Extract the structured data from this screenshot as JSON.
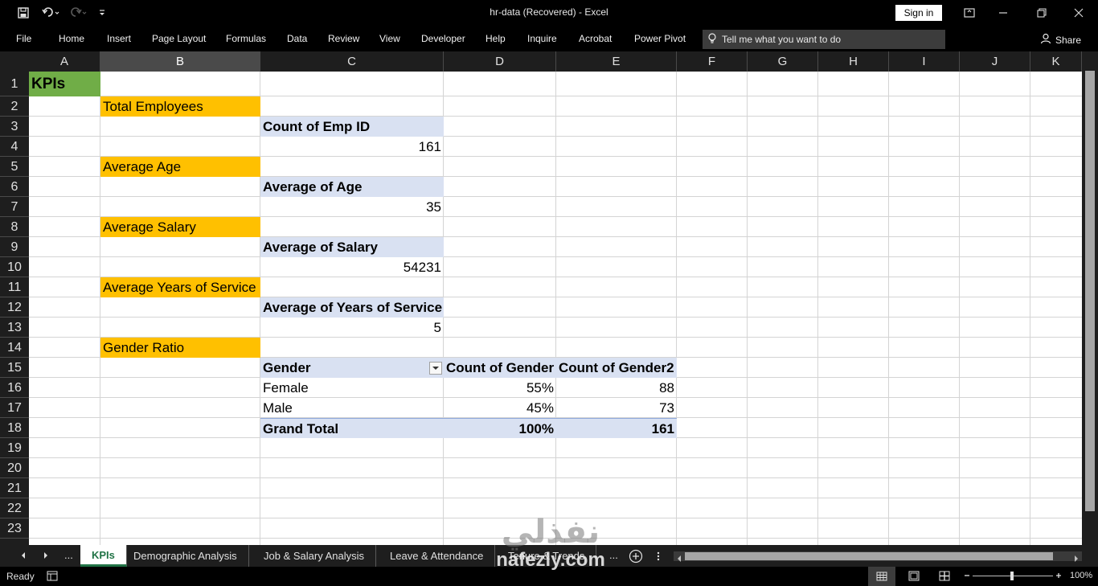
{
  "window": {
    "title": "hr-data (Recovered)  -  Excel",
    "signin_label": "Sign in",
    "share_label": "Share"
  },
  "ribbon": {
    "tabs": [
      "File",
      "Home",
      "Insert",
      "Page Layout",
      "Formulas",
      "Data",
      "Review",
      "View",
      "Developer",
      "Help",
      "Inquire",
      "Acrobat",
      "Power Pivot"
    ],
    "tell_me_placeholder": "Tell me what you want to do"
  },
  "columns": [
    "A",
    "B",
    "C",
    "D",
    "E",
    "F",
    "G",
    "H",
    "I",
    "J",
    "K"
  ],
  "selected_column": "B",
  "rows": [
    "1",
    "2",
    "3",
    "4",
    "5",
    "6",
    "7",
    "8",
    "9",
    "10",
    "11",
    "12",
    "13",
    "14",
    "15",
    "16",
    "17",
    "18",
    "19",
    "20",
    "21",
    "22",
    "23"
  ],
  "sheet": {
    "a1_title": "KPIs",
    "kpis": [
      {
        "label": "Total Employees",
        "header": "Count of Emp ID",
        "value": "161"
      },
      {
        "label": "Average Age",
        "header": "Average of Age",
        "value": "35"
      },
      {
        "label": "Average Salary",
        "header": "Average of Salary",
        "value": "54231"
      },
      {
        "label": "Average Years of Service",
        "header": "Average of Years of Service",
        "value": "5"
      }
    ],
    "gender": {
      "label": "Gender Ratio",
      "headers": [
        "Gender",
        "Count of Gender",
        "Count of Gender2"
      ],
      "rows": [
        {
          "name": "Female",
          "pct": "55%",
          "count": "88"
        },
        {
          "name": "Male",
          "pct": "45%",
          "count": "73"
        }
      ],
      "total": {
        "name": "Grand Total",
        "pct": "100%",
        "count": "161"
      }
    }
  },
  "sheet_tabs": {
    "ellipsis": "...",
    "tabs": [
      "KPIs",
      "Demographic Analysis",
      "Job & Salary Analysis",
      "Leave & Attendance",
      "Tenure & Trends"
    ],
    "active": "KPIs"
  },
  "status": {
    "ready": "Ready",
    "zoom": "100%"
  },
  "watermark": {
    "arabic": "نفذلي",
    "latin": "nafezly.com"
  },
  "colors": {
    "kpi_label_fill": "#ffc000",
    "title_fill": "#70ad47",
    "pivot_header_fill": "#d9e1f2",
    "accent": "#217346"
  }
}
